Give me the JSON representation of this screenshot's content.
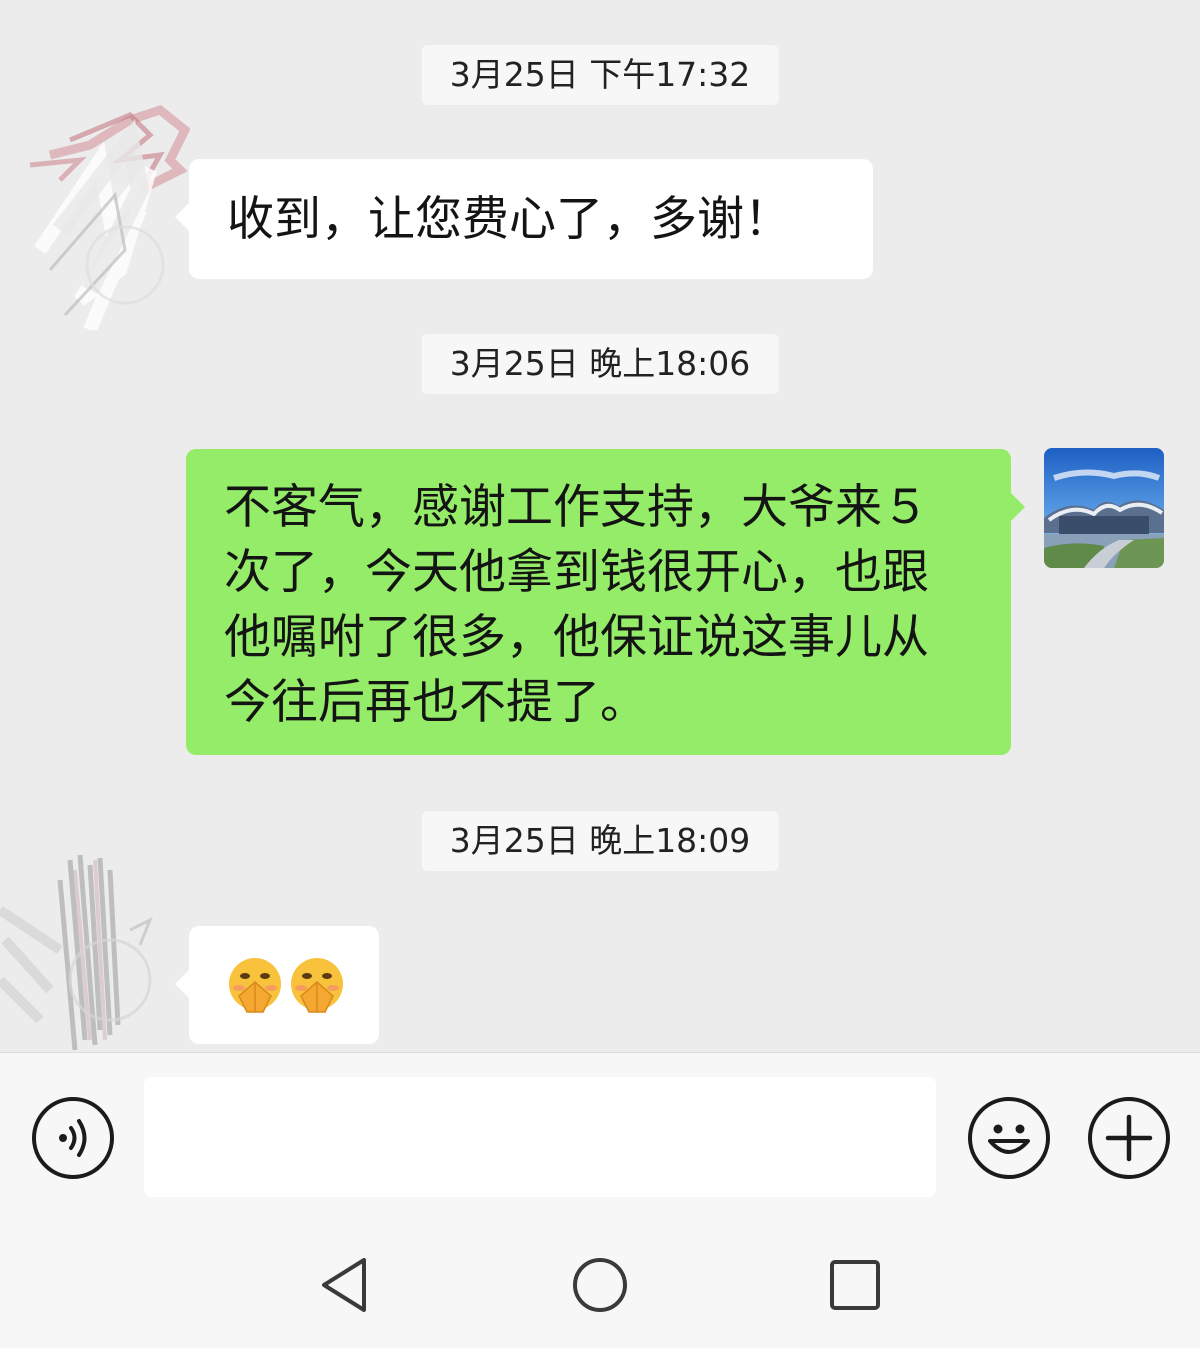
{
  "messages": [
    {
      "type": "timestamp",
      "text": "3月25日 下午17:32"
    },
    {
      "type": "incoming",
      "text": "收到，让您费心了，多谢！"
    },
    {
      "type": "timestamp",
      "text": "3月25日 晚上18:06"
    },
    {
      "type": "outgoing",
      "lines": [
        "不客气，感谢工作支持，大爷来５",
        "次了，今天他拿到钱很开心，也跟",
        "他嘱咐了很多，他保证说这事儿从",
        "今往后再也不提了。"
      ]
    },
    {
      "type": "timestamp",
      "text": "3月25日 晚上18:09"
    },
    {
      "type": "incoming-emoji",
      "emoji": [
        "grimace-pray-emoji",
        "grimace-pray-emoji"
      ]
    }
  ],
  "input_bar": {
    "placeholder": "",
    "icons": [
      "voice-icon",
      "emoji-icon",
      "plus-icon"
    ]
  },
  "nav_bar": {
    "icons": [
      "back-triangle-icon",
      "home-circle-icon",
      "recents-square-icon"
    ]
  },
  "colors": {
    "chat_background": "#ececec",
    "incoming_bubble": "#ffffff",
    "outgoing_bubble": "#95ec69",
    "timestamp_background": "#f7f7f7"
  }
}
